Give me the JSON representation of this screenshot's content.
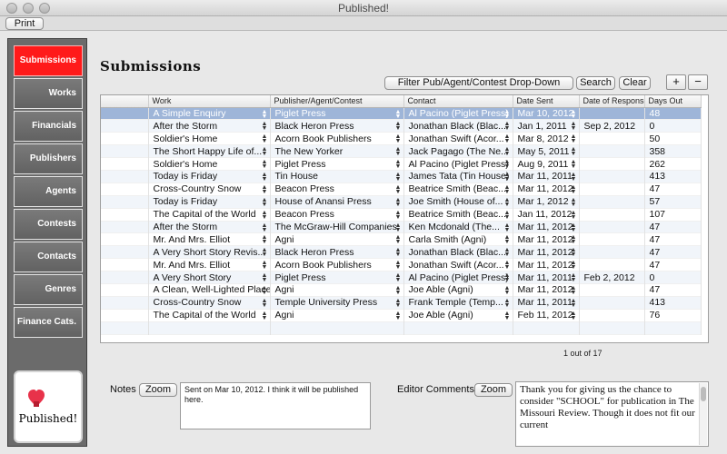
{
  "window": {
    "title": "Published!"
  },
  "toolbar": {
    "print_label": "Print"
  },
  "sidebar": {
    "items": [
      {
        "label": "Submissions",
        "active": true
      },
      {
        "label": "Works",
        "active": false
      },
      {
        "label": "Financials",
        "active": false
      },
      {
        "label": "Publishers",
        "active": false
      },
      {
        "label": "Agents",
        "active": false
      },
      {
        "label": "Contests",
        "active": false
      },
      {
        "label": "Contacts",
        "active": false
      },
      {
        "label": "Genres",
        "active": false
      },
      {
        "label": "Finance Cats.",
        "active": false
      }
    ],
    "logo_text": "Published!"
  },
  "main": {
    "title": "Submissions",
    "filter_label": "Filter Pub/Agent/Contest Drop-Down",
    "search_label": "Search",
    "clear_label": "Clear",
    "add_label": "+",
    "remove_label": "−",
    "pager_text": "1 out of 17"
  },
  "table": {
    "columns": [
      "Work",
      "Publisher/Agent/Contest",
      "Contact",
      "Date Sent",
      "Date of Response",
      "Days Out"
    ],
    "rows": [
      [
        "A Simple Enquiry",
        "Piglet Press",
        "Al Pacino (Piglet Press)",
        "Mar 10, 2012",
        "",
        "48"
      ],
      [
        "After the Storm",
        "Black Heron Press",
        "Jonathan Black (Blac...",
        "Jan 1, 2011",
        "Sep 2, 2012",
        "0"
      ],
      [
        "Soldier's Home",
        "Acorn Book Publishers",
        "Jonathan Swift (Acor...",
        "Mar 8, 2012",
        "",
        "50"
      ],
      [
        "The Short Happy Life of...",
        "The New Yorker",
        "Jack Pagago (The Ne...",
        "May 5, 2011",
        "",
        "358"
      ],
      [
        "Soldier's Home",
        "Piglet Press",
        "Al Pacino (Piglet Press)",
        "Aug 9, 2011",
        "",
        "262"
      ],
      [
        "Today is Friday",
        "Tin House",
        "James Tata (Tin House)",
        "Mar 11, 2011",
        "",
        "413"
      ],
      [
        "Cross-Country Snow",
        "Beacon Press",
        "Beatrice Smith (Beac...",
        "Mar 11, 2012",
        "",
        "47"
      ],
      [
        "Today is Friday",
        "House of Anansi Press",
        "Joe Smith (House of...",
        "Mar 1, 2012",
        "",
        "57"
      ],
      [
        "The Capital of the World",
        "Beacon Press",
        "Beatrice Smith (Beac...",
        "Jan 11, 2012",
        "",
        "107"
      ],
      [
        "After the Storm",
        "The McGraw-Hill Companies",
        "Ken Mcdonald (The...",
        "Mar 11, 2012",
        "",
        "47"
      ],
      [
        "Mr. And Mrs. Elliot",
        "Agni",
        "Carla Smith (Agni)",
        "Mar 11, 2012",
        "",
        "47"
      ],
      [
        "A Very Short Story Revis...",
        "Black Heron Press",
        "Jonathan Black (Blac...",
        "Mar 11, 2012",
        "",
        "47"
      ],
      [
        "Mr. And Mrs. Elliot",
        "Acorn Book Publishers",
        "Jonathan Swift (Acor...",
        "Mar 11, 2012",
        "",
        "47"
      ],
      [
        "A Very Short Story",
        "Piglet Press",
        "Al Pacino (Piglet Press)",
        "Mar 11, 2011",
        "Feb 2, 2012",
        "0"
      ],
      [
        "A Clean, Well-Lighted Place",
        "Agni",
        "Joe Able (Agni)",
        "Mar 11, 2012",
        "",
        "47"
      ],
      [
        "Cross-Country Snow",
        "Temple University Press",
        "Frank Temple (Temp...",
        "Mar 11, 2011",
        "",
        "413"
      ],
      [
        "The Capital of the World",
        "Agni",
        "Joe Able (Agni)",
        "Feb 11, 2012",
        "",
        "76"
      ]
    ]
  },
  "notes": {
    "label": "Notes",
    "zoom_label": "Zoom",
    "text": "Sent on Mar 10, 2012. I think it will be published here."
  },
  "editor_comments": {
    "label": "Editor Comments",
    "zoom_label": "Zoom",
    "text": "Thank you for giving us the chance to consider \"SCHOOL\" for publication in The Missouri Review. Though it does not fit our current"
  }
}
